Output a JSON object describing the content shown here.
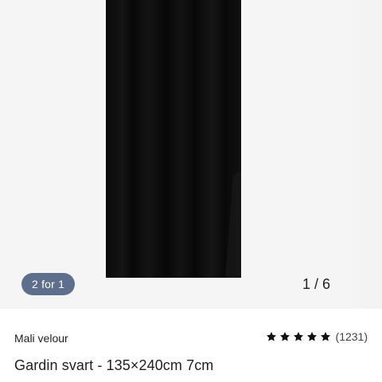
{
  "carousel": {
    "promo_badge": "2 for 1",
    "pager": "1 / 6",
    "image_icon": "curtain-image"
  },
  "product": {
    "brand": "Mali velour",
    "title": "Gardin svart - 135×240cm 7cm",
    "rating": {
      "stars": 5,
      "max_stars": 5,
      "count_label": "(1231)",
      "star_icon": "star-icon",
      "star_color": "#111111"
    }
  },
  "colors": {
    "badge_bg": "#5d6f8c",
    "carousel_bg": "#f5f5f5",
    "curtain": "#0b0b0b"
  }
}
